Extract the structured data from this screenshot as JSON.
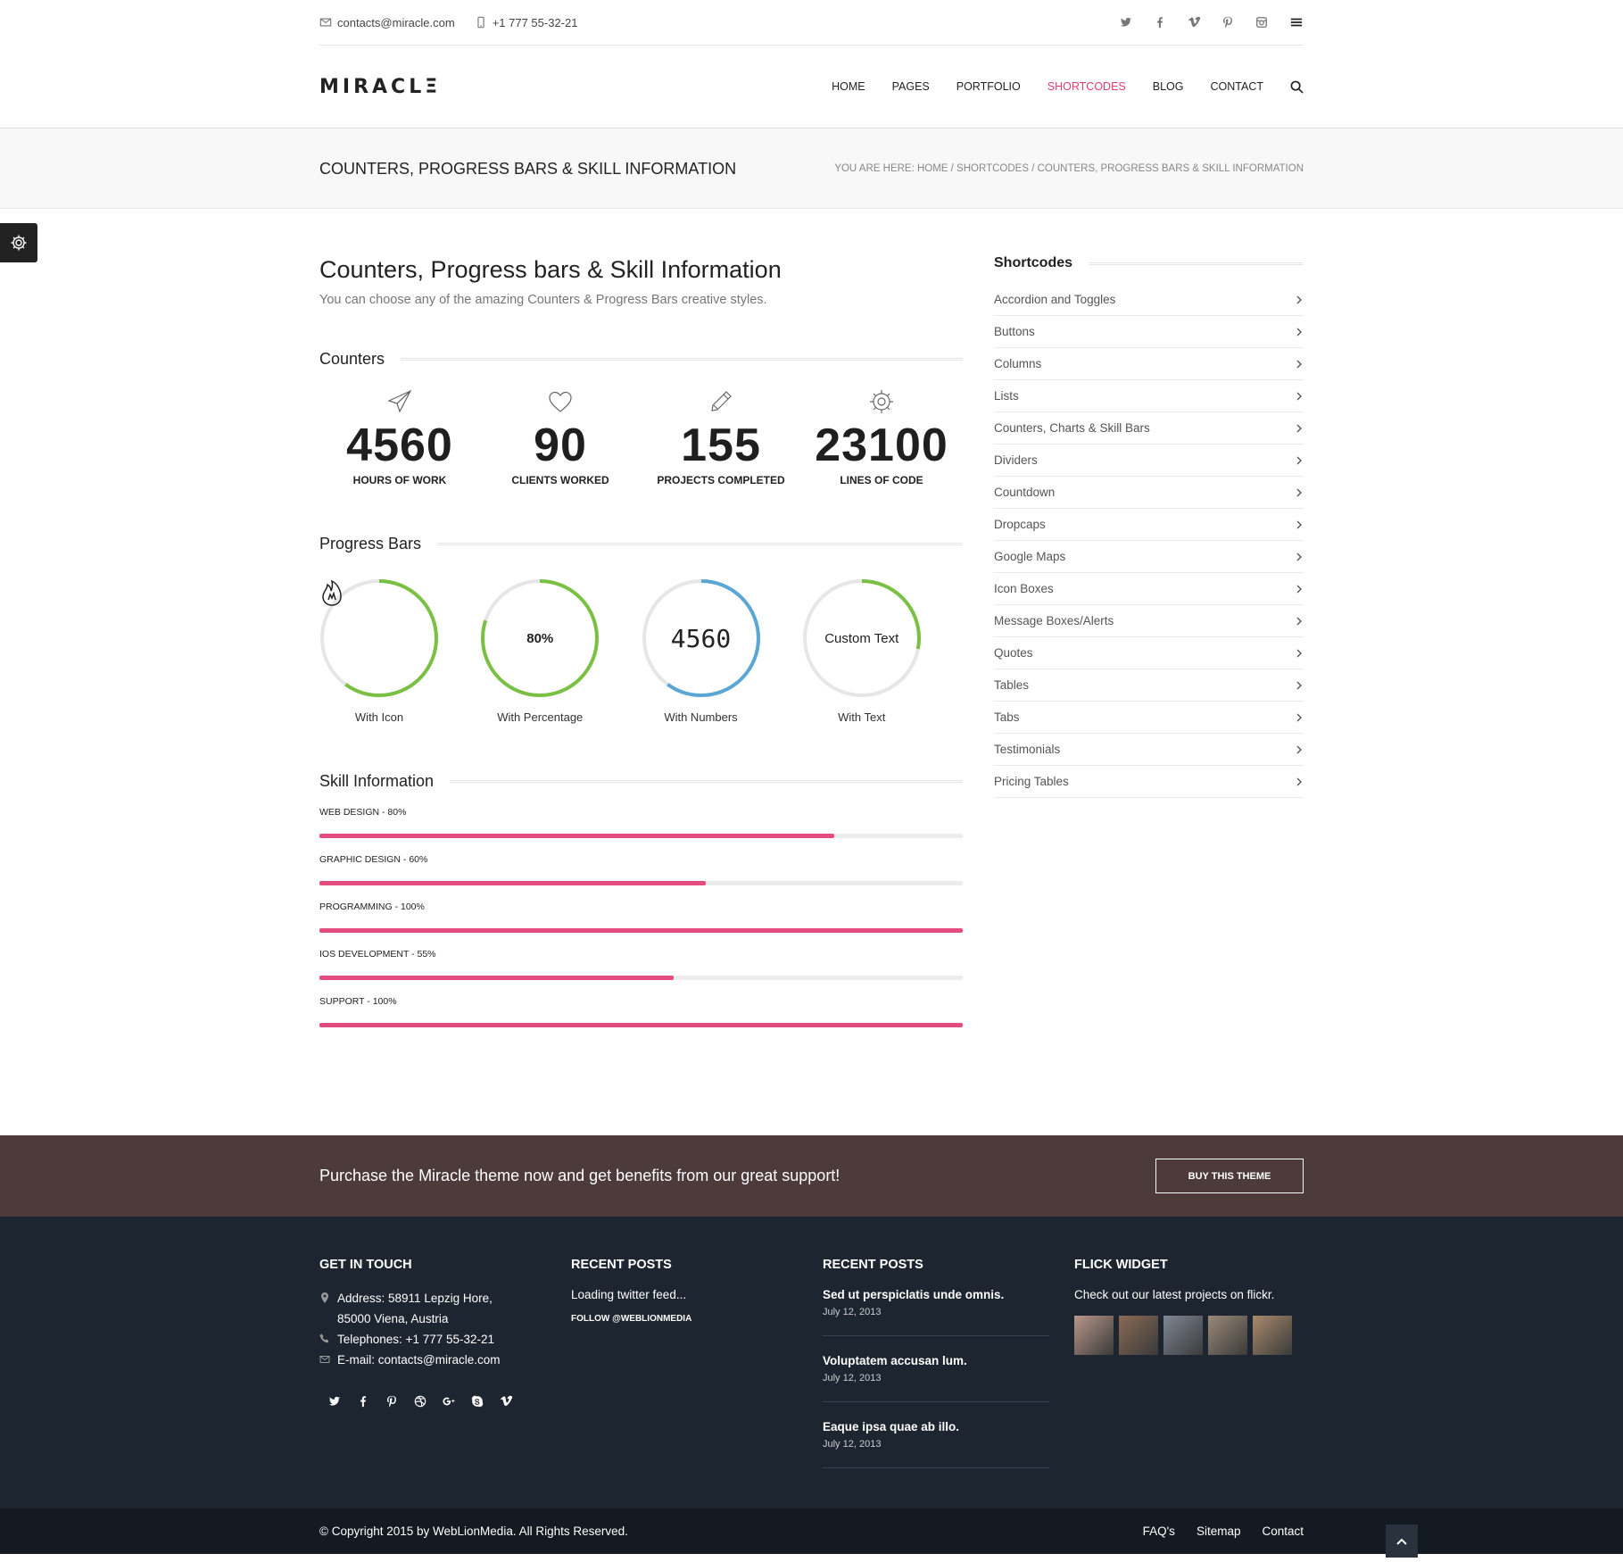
{
  "topbar": {
    "email": "contacts@miracle.com",
    "phone": "+1 777 55-32-21",
    "social_icons": [
      "twitter-icon",
      "facebook-icon",
      "vimeo-icon",
      "pinterest-icon",
      "instagram-icon"
    ]
  },
  "header": {
    "logo": "MIRACLΞ",
    "nav": [
      "HOME",
      "PAGES",
      "PORTFOLIO",
      "SHORTCODES",
      "BLOG",
      "CONTACT"
    ],
    "active_nav": "SHORTCODES",
    "accent_color": "#e43c6c"
  },
  "titlebar": {
    "title": "COUNTERS, PROGRESS BARS & SKILL INFORMATION",
    "breadcrumb": "YOU ARE HERE: HOME / SHORTCODES / COUNTERS, PROGRESS BARS & SKILL INFORMATION"
  },
  "main": {
    "heading": "Counters, Progress bars & Skill Information",
    "lead": "You can choose any of the amazing Counters & Progress Bars creative styles.",
    "counters_title": "Counters",
    "counters": [
      {
        "icon": "paper-plane-icon",
        "value": "4560",
        "label": "HOURS OF WORK"
      },
      {
        "icon": "heart-icon",
        "value": "90",
        "label": "CLIENTS WORKED"
      },
      {
        "icon": "pencil-icon",
        "value": "155",
        "label": "PROJECTS COMPLETED"
      },
      {
        "icon": "gear-icon",
        "value": "23100",
        "label": "LINES OF CODE"
      }
    ],
    "progress_title": "Progress Bars",
    "circles": [
      {
        "center": "",
        "center_icon": "fire-icon",
        "label": "With Icon",
        "progress": 0.6,
        "color": "#7ac143"
      },
      {
        "center": "80%",
        "label": "With Percentage",
        "progress": 0.8,
        "color": "#7ac143"
      },
      {
        "center": "4560",
        "label": "With Numbers",
        "progress": 0.6,
        "color": "#5aa7d6"
      },
      {
        "center": "Custom Text",
        "label": "With Text",
        "progress": 0.28,
        "color": "#7ac143"
      }
    ],
    "skills_title": "Skill Information",
    "skills": [
      {
        "label": "WEB DESIGN - 80%",
        "value": 80
      },
      {
        "label": "GRAPHIC DESIGN - 60%",
        "value": 60
      },
      {
        "label": "PROGRAMMING - 100%",
        "value": 100
      },
      {
        "label": "IOS DEVELOPMENT - 55%",
        "value": 55
      },
      {
        "label": "SUPPORT - 100%",
        "value": 100
      }
    ],
    "skill_color": "#e44b7e"
  },
  "sidebar": {
    "title": "Shortcodes",
    "items": [
      "Accordion and Toggles",
      "Buttons",
      "Columns",
      "Lists",
      "Counters, Charts & Skill Bars",
      "Dividers",
      "Countdown",
      "Dropcaps",
      "Google Maps",
      "Icon Boxes",
      "Message Boxes/Alerts",
      "Quotes",
      "Tables",
      "Tabs",
      "Testimonials",
      "Pricing Tables"
    ]
  },
  "purchase": {
    "text": "Purchase the Miracle theme now and get benefits from our great support!",
    "button": "BUY THIS THEME",
    "bg_color": "#4d3a3a"
  },
  "footer": {
    "col1": {
      "title": "GET IN TOUCH",
      "address1": "Address: 58911 Lepzig Hore,",
      "address2": "85000 Viena, Austria",
      "phone": "Telephones: +1 777 55-32-21",
      "email": "E-mail: contacts@miracle.com",
      "social_icons": [
        "twitter-icon",
        "facebook-icon",
        "pinterest-icon",
        "dribbble-icon",
        "google-plus-icon",
        "skype-icon",
        "vimeo-icon"
      ]
    },
    "col2": {
      "title": "RECENT POSTS",
      "loading": "Loading twitter feed...",
      "follow": "FOLLOW @WEBLIONMEDIA"
    },
    "col3": {
      "title": "RECENT POSTS",
      "posts": [
        {
          "title": "Sed ut perspiclatis unde omnis.",
          "date": "July 12, 2013"
        },
        {
          "title": "Voluptatem accusan lum.",
          "date": "July 12, 2013"
        },
        {
          "title": "Eaque ipsa quae ab illo.",
          "date": "July 12, 2013"
        }
      ]
    },
    "col4": {
      "title": "FLICK WIDGET",
      "text": "Check out our latest projects on flickr.",
      "thumb_colors": [
        "#b9968a",
        "#8a6a55",
        "#7f8794",
        "#9a8a78",
        "#a88a6c"
      ]
    },
    "bg_color": "#1d2530"
  },
  "bottom": {
    "copyright": "© Copyright 2015 by WebLionMedia. All Rights Reserved.",
    "links": [
      "FAQ's",
      "Sitemap",
      "Contact"
    ]
  }
}
